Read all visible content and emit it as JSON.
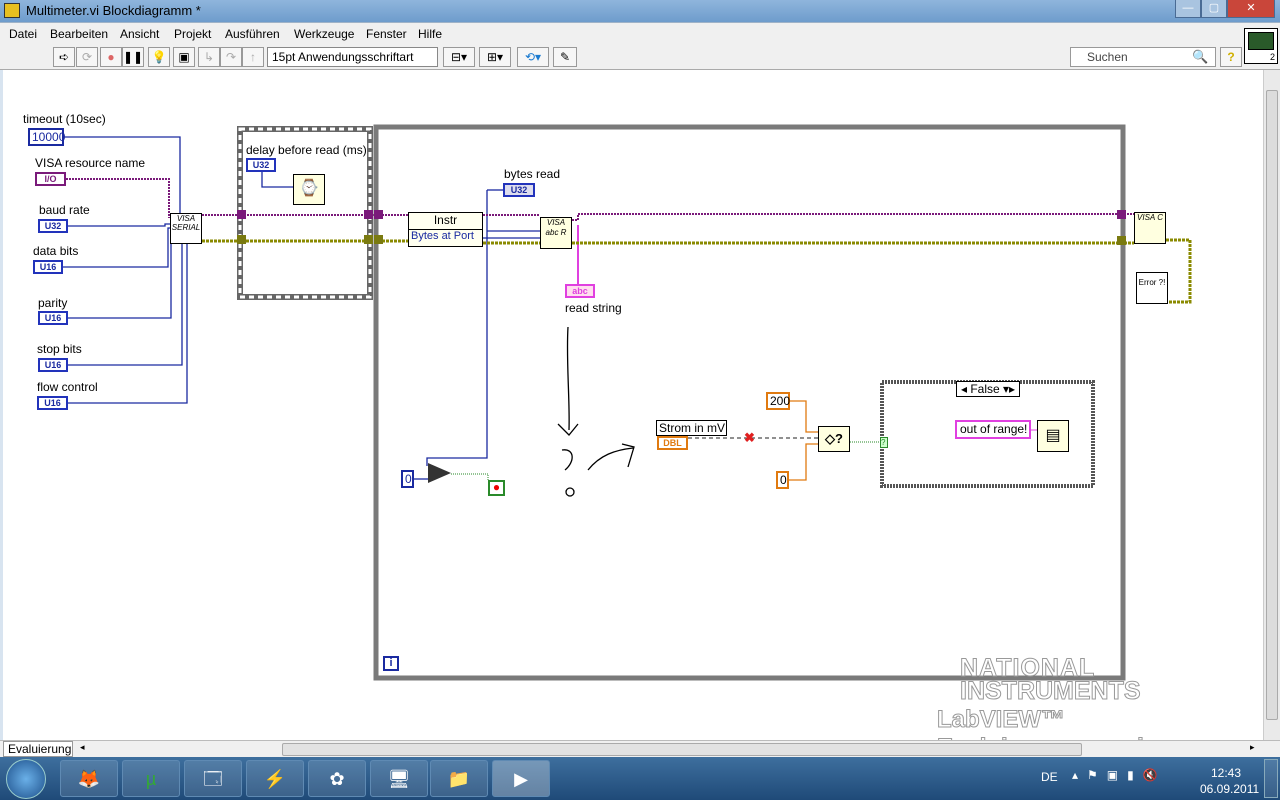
{
  "window": {
    "title": "Multimeter.vi Blockdiagramm *",
    "minimize": "—",
    "maximize": "▢",
    "close": "✕"
  },
  "menu": [
    "Datei",
    "Bearbeiten",
    "Ansicht",
    "Projekt",
    "Ausführen",
    "Werkzeuge",
    "Fenster",
    "Hilfe"
  ],
  "toolbar": {
    "font": "15pt Anwendungsschriftart",
    "search_placeholder": "Suchen",
    "help": "?",
    "vi_icon_number": "2"
  },
  "diagram": {
    "timeout_label": "timeout (10sec)",
    "timeout_value": "10000",
    "visa_resource_label": "VISA resource name",
    "visa_resource_type": "I/O",
    "baud_label": "baud rate",
    "baud_type": "U32",
    "databits_label": "data bits",
    "databits_type": "U16",
    "parity_label": "parity",
    "parity_type": "U16",
    "stopbits_label": "stop bits",
    "stopbits_type": "U16",
    "flow_label": "flow control",
    "flow_type": "U16",
    "visa_serial_node": "VISA SERIAL",
    "delay_label": "delay before read (ms)",
    "delay_type": "U32",
    "property_class": "Instr",
    "property_item": "Bytes at Port",
    "bytes_read_label": "bytes read",
    "bytes_read_type": "U32",
    "visa_read_node": "VISA abc R",
    "read_string_type": "abc",
    "read_string_label": "read string",
    "compare_zero": "0",
    "iteration": "i",
    "strom_label": "Strom in mV",
    "strom_type": "DBL",
    "upper_limit": "200",
    "lower_limit": "0",
    "case_selector": "False",
    "message": "out of range!",
    "visa_close_node": "VISA C",
    "error_node": "Error ?!"
  },
  "watermark": {
    "line1": "NATIONAL",
    "line2": "INSTRUMENTS",
    "line3": "LabVIEW™ Evaluierungsversion"
  },
  "bottom": {
    "tab": "Evaluierung"
  },
  "taskbar": {
    "lang": "DE",
    "time": "12:43",
    "date": "06.09.2011"
  },
  "colors": {
    "visa_wire": "#7a1a7a",
    "error_wire": "#8a8a00",
    "numeric_wire": "#1a2aa0",
    "dbl_wire": "#e07a10",
    "string_wire": "#e040e0"
  }
}
